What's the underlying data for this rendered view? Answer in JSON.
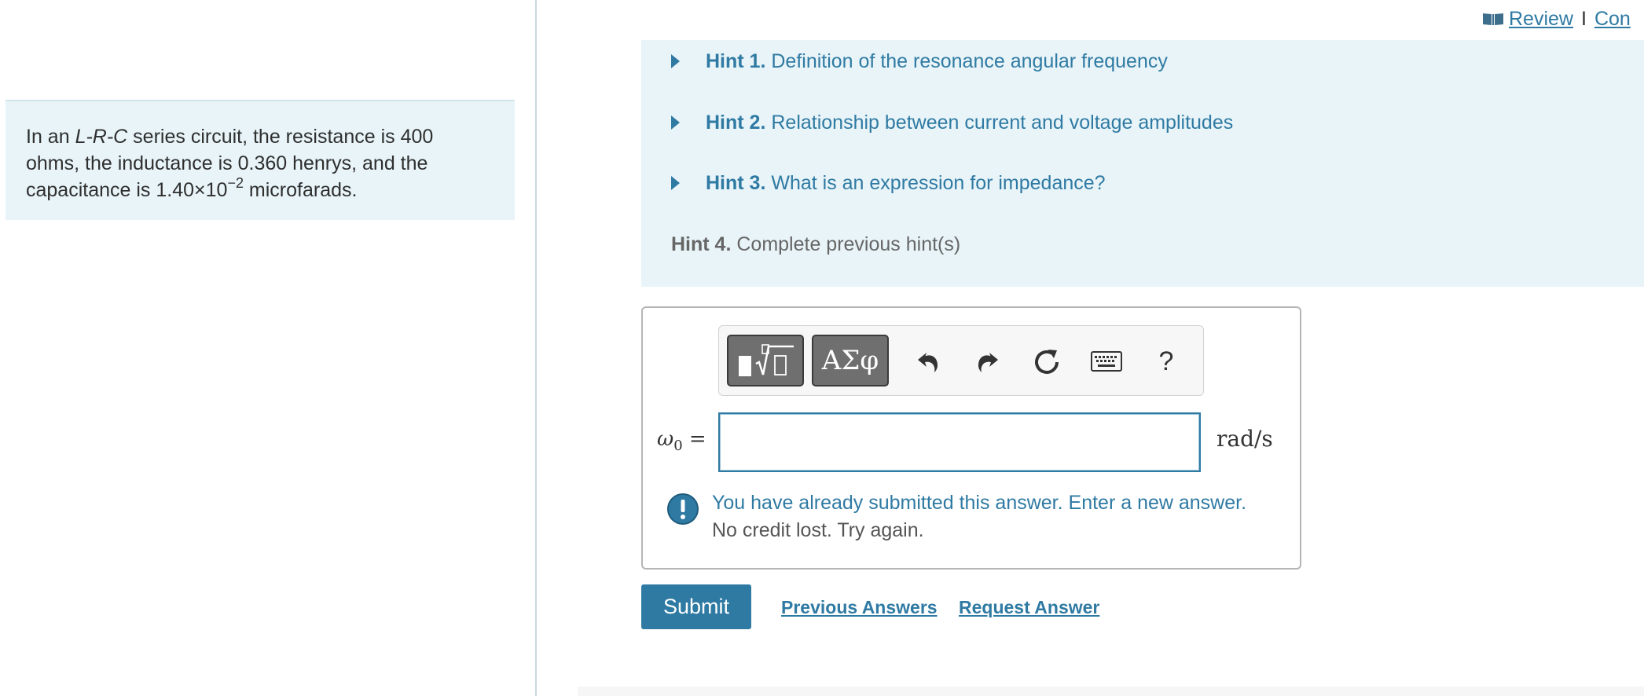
{
  "problem": {
    "text_before": "In an ",
    "circuit": "L-R-C",
    "text_middle": " series circuit, the resistance is 400 ohms, the inductance is 0.360 henrys, and the capacitance is 1.40×10",
    "exponent": "−2",
    "text_after": " microfarads."
  },
  "top_links": {
    "review": "Review",
    "separator": "I",
    "constants": "Con"
  },
  "hints": [
    {
      "number": "Hint 1.",
      "text": "Definition of the resonance angular frequency",
      "enabled": true
    },
    {
      "number": "Hint 2.",
      "text": "Relationship between current and voltage amplitudes",
      "enabled": true
    },
    {
      "number": "Hint 3.",
      "text": "What is an expression for impedance?",
      "enabled": true
    },
    {
      "number": "Hint 4.",
      "text": "Complete previous hint(s)",
      "enabled": false
    }
  ],
  "toolbar": {
    "templates_icon": "radical-template-icon",
    "greek_label": "ΑΣφ",
    "undo_icon": "undo-icon",
    "redo_icon": "redo-icon",
    "reset_icon": "reset-icon",
    "keyboard_icon": "keyboard-icon",
    "help_label": "?"
  },
  "answer": {
    "variable": "ω",
    "subscript": "0",
    "equals": "=",
    "value": "",
    "unit": "rad/s"
  },
  "feedback": {
    "line1": "You have already submitted this answer. Enter a new answer.",
    "line2": "No credit lost. Try again."
  },
  "actions": {
    "submit": "Submit",
    "previous_answers": "Previous Answers",
    "request_answer": "Request Answer"
  },
  "colors": {
    "accent": "#2f7aa3",
    "panel_bg": "#e8f4f8",
    "disabled_text": "#666666"
  }
}
